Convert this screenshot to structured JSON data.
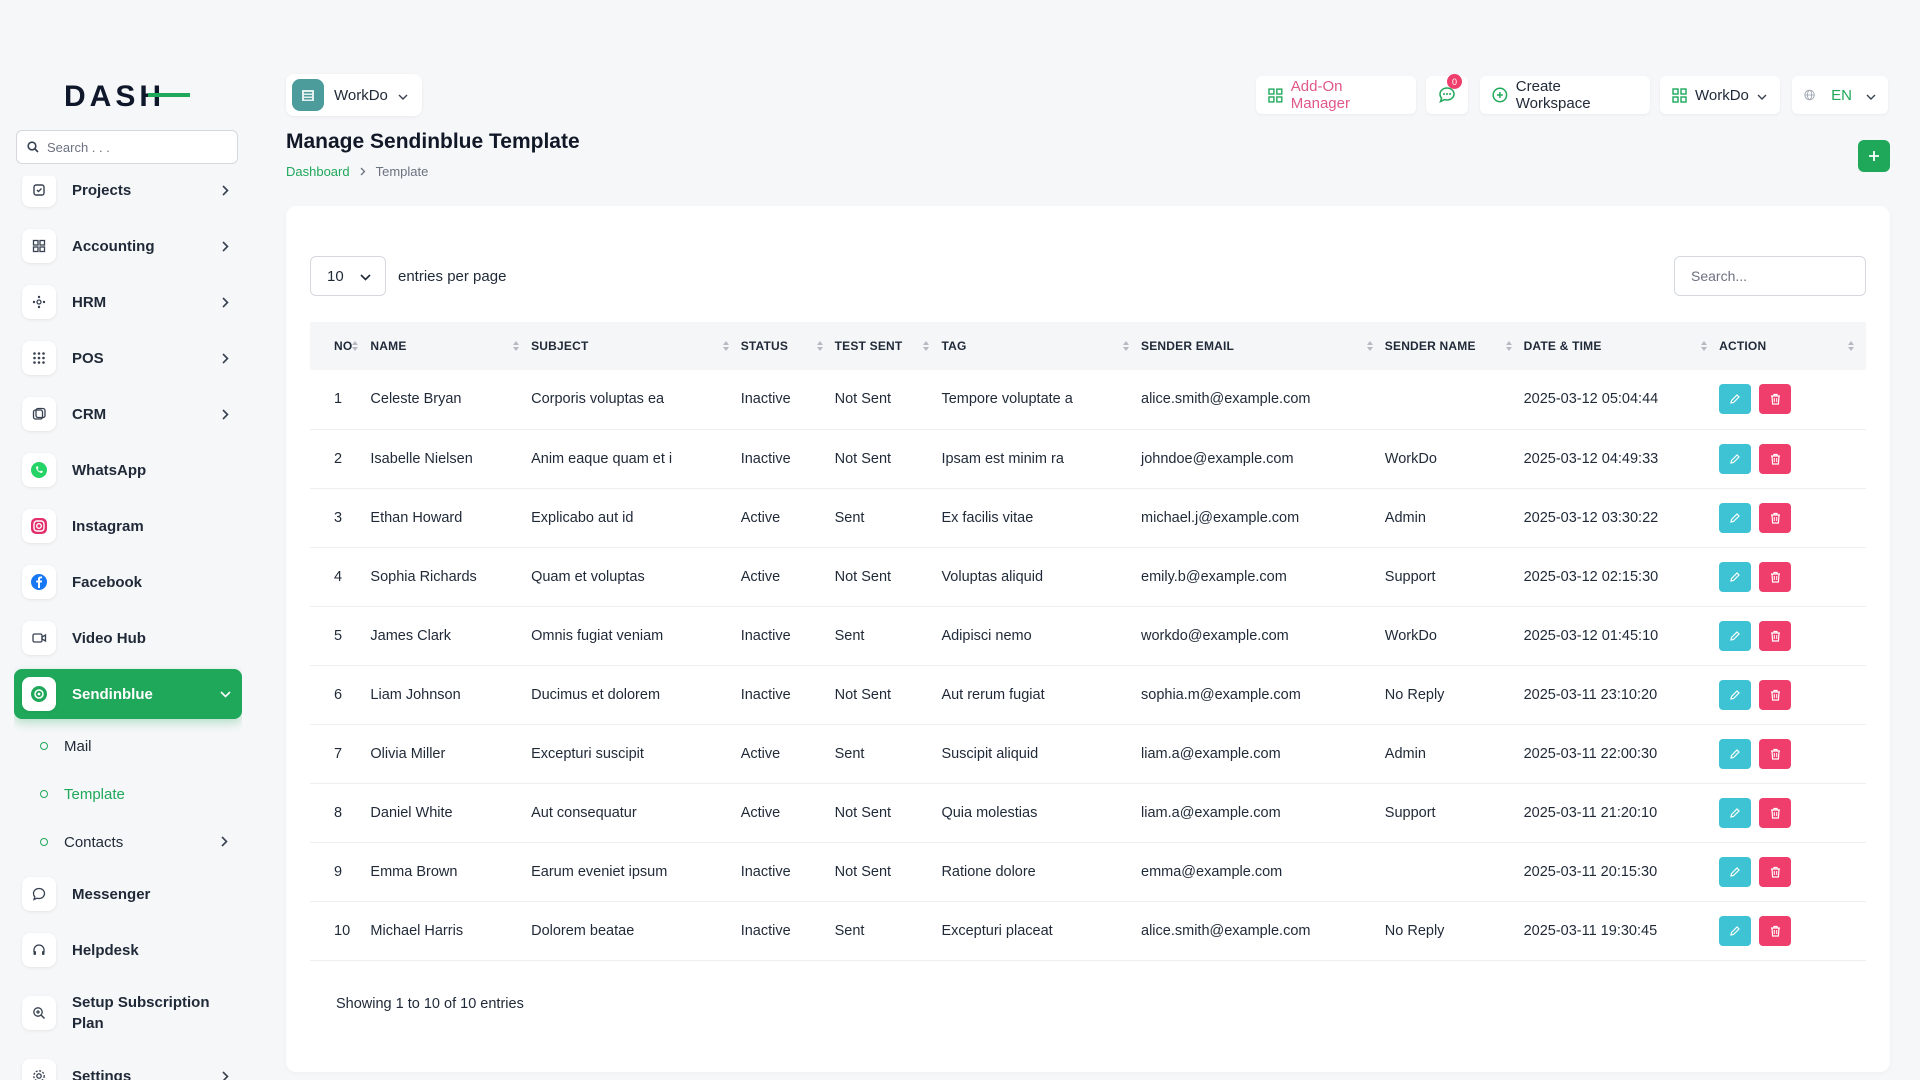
{
  "brand": "DASH",
  "sidebar": {
    "search_placeholder": "Search . . .",
    "items": [
      {
        "label": "Projects",
        "icon": "projects-icon",
        "has_chevron": true
      },
      {
        "label": "Accounting",
        "icon": "accounting-icon",
        "has_chevron": true
      },
      {
        "label": "HRM",
        "icon": "hrm-icon",
        "has_chevron": true
      },
      {
        "label": "POS",
        "icon": "pos-icon",
        "has_chevron": true
      },
      {
        "label": "CRM",
        "icon": "crm-icon",
        "has_chevron": true
      },
      {
        "label": "WhatsApp",
        "icon": "whatsapp-icon",
        "has_chevron": false
      },
      {
        "label": "Instagram",
        "icon": "instagram-icon",
        "has_chevron": false
      },
      {
        "label": "Facebook",
        "icon": "facebook-icon",
        "has_chevron": false
      },
      {
        "label": "Video Hub",
        "icon": "video-hub-icon",
        "has_chevron": false
      },
      {
        "label": "Sendinblue",
        "icon": "sendinblue-icon",
        "has_chevron": true,
        "active": true
      }
    ],
    "sub_items": [
      {
        "label": "Mail"
      },
      {
        "label": "Template",
        "active": true
      },
      {
        "label": "Contacts",
        "has_chevron": true
      }
    ],
    "items_after": [
      {
        "label": "Messenger",
        "icon": "messenger-icon"
      },
      {
        "label": "Helpdesk",
        "icon": "helpdesk-icon"
      },
      {
        "label": "Setup Subscription Plan",
        "icon": "subscription-icon"
      },
      {
        "label": "Settings",
        "icon": "settings-icon",
        "has_chevron": true
      }
    ]
  },
  "header": {
    "workspace": "WorkDo",
    "addon_manager": "Add-On Manager",
    "chat_badge": "0",
    "create_workspace": "Create Workspace",
    "workspace_switch": "WorkDo",
    "language": "EN"
  },
  "page": {
    "title": "Manage Sendinblue Template",
    "breadcrumb": [
      "Dashboard",
      "Template"
    ]
  },
  "table": {
    "entries_value": "10",
    "entries_label": "entries per page",
    "search_placeholder": "Search...",
    "columns": [
      "NO",
      "NAME",
      "SUBJECT",
      "STATUS",
      "TEST SENT",
      "TAG",
      "SENDER EMAIL",
      "SENDER NAME",
      "DATE & TIME",
      "ACTION"
    ],
    "rows": [
      [
        "1",
        "Celeste Bryan",
        "Corporis voluptas ea",
        "Inactive",
        "Not Sent",
        "Tempore voluptate a",
        "alice.smith@example.com",
        "",
        "2025-03-12 05:04:44"
      ],
      [
        "2",
        "Isabelle Nielsen",
        "Anim eaque quam et i",
        "Inactive",
        "Not Sent",
        "Ipsam est minim ra",
        "johndoe@example.com",
        "WorkDo",
        "2025-03-12 04:49:33"
      ],
      [
        "3",
        "Ethan Howard",
        "Explicabo aut id",
        "Active",
        "Sent",
        "Ex facilis vitae",
        "michael.j@example.com",
        "Admin",
        "2025-03-12 03:30:22"
      ],
      [
        "4",
        "Sophia Richards",
        "Quam et voluptas",
        "Active",
        "Not Sent",
        "Voluptas aliquid",
        "emily.b@example.com",
        "Support",
        "2025-03-12 02:15:30"
      ],
      [
        "5",
        "James Clark",
        "Omnis fugiat veniam",
        "Inactive",
        "Sent",
        "Adipisci nemo",
        "workdo@example.com",
        "WorkDo",
        "2025-03-12 01:45:10"
      ],
      [
        "6",
        "Liam Johnson",
        "Ducimus et dolorem",
        "Inactive",
        "Not Sent",
        "Aut rerum fugiat",
        "sophia.m@example.com",
        "No Reply",
        "2025-03-11 23:10:20"
      ],
      [
        "7",
        "Olivia Miller",
        "Excepturi suscipit",
        "Active",
        "Sent",
        "Suscipit aliquid",
        "liam.a@example.com",
        "Admin",
        "2025-03-11 22:00:30"
      ],
      [
        "8",
        "Daniel White",
        "Aut consequatur",
        "Active",
        "Not Sent",
        "Quia molestias",
        "liam.a@example.com",
        "Support",
        "2025-03-11 21:20:10"
      ],
      [
        "9",
        "Emma Brown",
        "Earum eveniet ipsum",
        "Inactive",
        "Not Sent",
        "Ratione dolore",
        "emma@example.com",
        "",
        "2025-03-11 20:15:30"
      ],
      [
        "10",
        "Michael Harris",
        "Dolorem beatae",
        "Inactive",
        "Sent",
        "Excepturi placeat",
        "alice.smith@example.com",
        "No Reply",
        "2025-03-11 19:30:45"
      ]
    ],
    "showing": "Showing 1 to 10 of 10 entries"
  },
  "colors": {
    "accent": "#1fa85a",
    "edit": "#3ec3d5",
    "delete": "#ef3e6b",
    "addon": "#e0578a"
  }
}
